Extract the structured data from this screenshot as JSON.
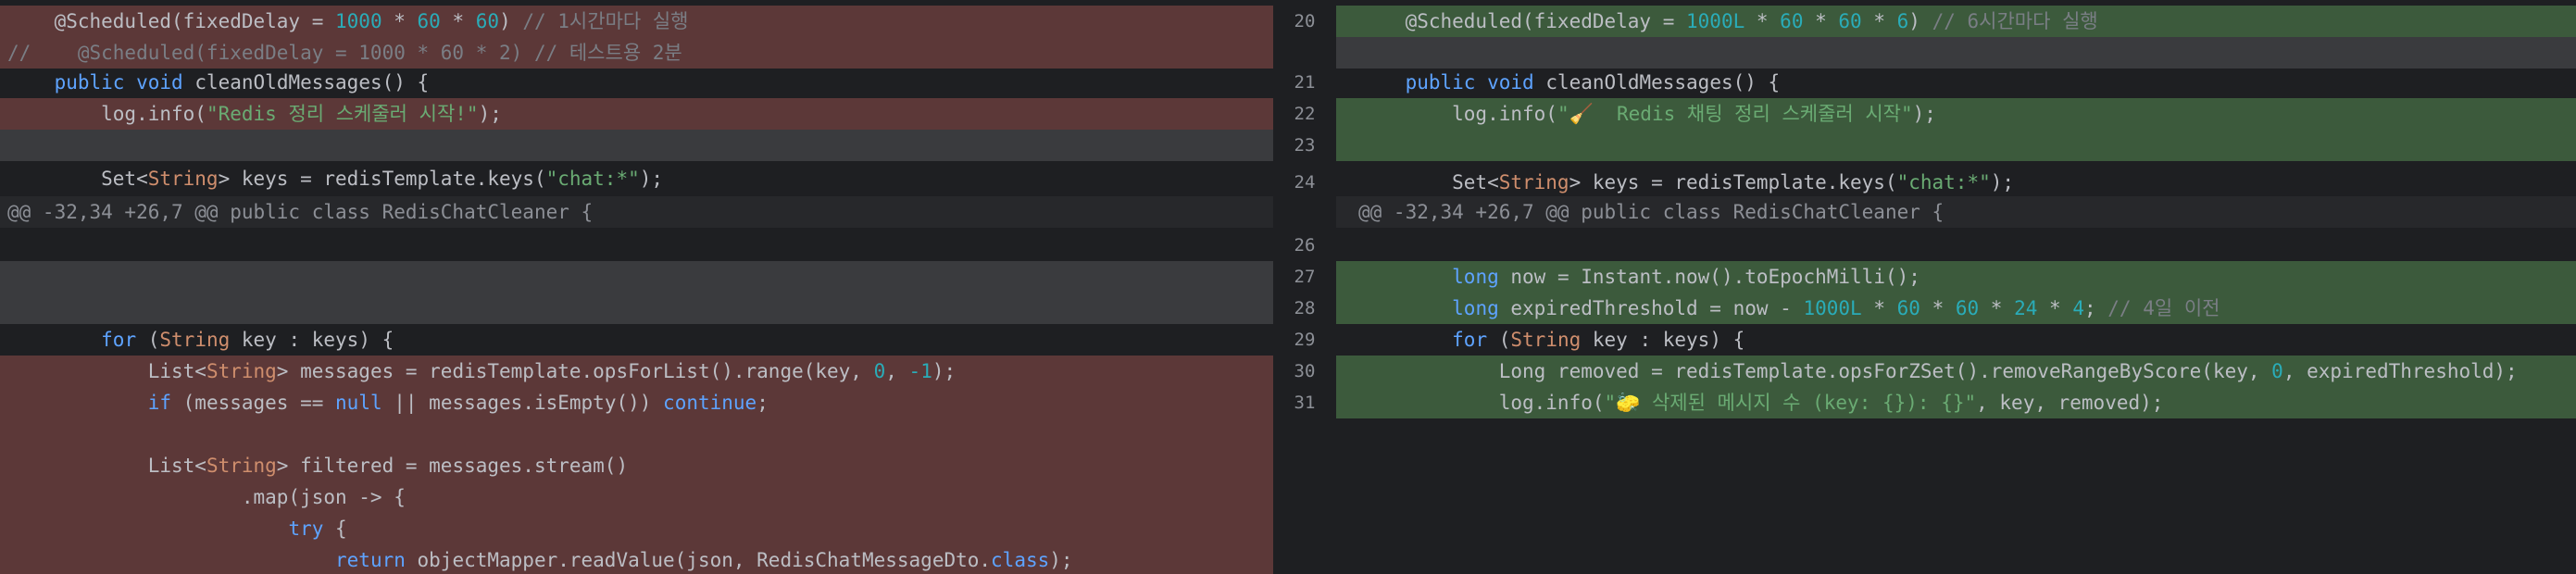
{
  "left": {
    "lines": [
      {
        "kind": "del",
        "segments": [
          {
            "t": "    @Scheduled(fixedDelay = "
          },
          {
            "t": "1000",
            "c": "num"
          },
          {
            "t": " * "
          },
          {
            "t": "60",
            "c": "num"
          },
          {
            "t": " * "
          },
          {
            "t": "60",
            "c": "num"
          },
          {
            "t": ") "
          },
          {
            "t": "// 1시간마다 실행",
            "c": "cmt"
          }
        ]
      },
      {
        "kind": "del",
        "segments": [
          {
            "t": "//    @Scheduled(fixedDelay = 1000 * 60 * 2) // 테스트용 2분",
            "c": "cmt"
          }
        ]
      },
      {
        "kind": "ctx",
        "segments": [
          {
            "t": "    "
          },
          {
            "t": "public",
            "c": "kw2"
          },
          {
            "t": " "
          },
          {
            "t": "void",
            "c": "kw2"
          },
          {
            "t": " cleanOldMessages() {"
          }
        ]
      },
      {
        "kind": "del",
        "segments": [
          {
            "t": "        log.info("
          },
          {
            "t": "\"Redis 정리 스케줄러 시작!\"",
            "c": "str"
          },
          {
            "t": ");"
          }
        ]
      },
      {
        "kind": "blank",
        "segments": []
      },
      {
        "kind": "ctx",
        "segments": [
          {
            "t": "        Set<"
          },
          {
            "t": "String",
            "c": "kw"
          },
          {
            "t": "> keys = redisTemplate.keys("
          },
          {
            "t": "\"chat:*\"",
            "c": "str"
          },
          {
            "t": ");"
          }
        ]
      },
      {
        "kind": "hunk",
        "segments": [
          {
            "t": "@@ -32,34 +26,7 @@ public class RedisChatCleaner {"
          }
        ]
      },
      {
        "kind": "ctx",
        "segments": []
      },
      {
        "kind": "blank",
        "segments": []
      },
      {
        "kind": "blank",
        "segments": []
      },
      {
        "kind": "ctx",
        "segments": [
          {
            "t": "        "
          },
          {
            "t": "for",
            "c": "kw2"
          },
          {
            "t": " ("
          },
          {
            "t": "String",
            "c": "kw"
          },
          {
            "t": " key : keys) {"
          }
        ]
      },
      {
        "kind": "del",
        "segments": [
          {
            "t": "            List<"
          },
          {
            "t": "String",
            "c": "kw"
          },
          {
            "t": "> messages = redisTemplate.opsForList().range(key, "
          },
          {
            "t": "0",
            "c": "num"
          },
          {
            "t": ", "
          },
          {
            "t": "-1",
            "c": "num"
          },
          {
            "t": ");"
          }
        ]
      },
      {
        "kind": "del",
        "segments": [
          {
            "t": "            "
          },
          {
            "t": "if",
            "c": "kw2"
          },
          {
            "t": " (messages == "
          },
          {
            "t": "null",
            "c": "kw2"
          },
          {
            "t": " || messages.isEmpty()) "
          },
          {
            "t": "continue",
            "c": "kw2"
          },
          {
            "t": ";"
          }
        ]
      },
      {
        "kind": "del",
        "segments": []
      },
      {
        "kind": "del",
        "segments": [
          {
            "t": "            List<"
          },
          {
            "t": "String",
            "c": "kw"
          },
          {
            "t": "> filtered = messages.stream()"
          }
        ]
      },
      {
        "kind": "del",
        "segments": [
          {
            "t": "                    .map(json -> {"
          }
        ]
      },
      {
        "kind": "del",
        "segments": [
          {
            "t": "                        "
          },
          {
            "t": "try",
            "c": "kw2"
          },
          {
            "t": " {"
          }
        ]
      },
      {
        "kind": "del",
        "segments": [
          {
            "t": "                            "
          },
          {
            "t": "return",
            "c": "kw2"
          },
          {
            "t": " objectMapper.readValue(json, RedisChatMessageDto."
          },
          {
            "t": "class",
            "c": "kw2"
          },
          {
            "t": ");"
          }
        ]
      }
    ]
  },
  "right": {
    "lines": [
      {
        "kind": "add",
        "no": "20",
        "segments": [
          {
            "t": "    @Scheduled(fixedDelay = "
          },
          {
            "t": "1000L",
            "c": "num"
          },
          {
            "t": " * "
          },
          {
            "t": "60",
            "c": "num"
          },
          {
            "t": " * "
          },
          {
            "t": "60",
            "c": "num"
          },
          {
            "t": " * "
          },
          {
            "t": "6",
            "c": "num"
          },
          {
            "t": ") "
          },
          {
            "t": "// 6시간마다 실행",
            "c": "cmt"
          }
        ]
      },
      {
        "kind": "blank",
        "no": "",
        "segments": []
      },
      {
        "kind": "ctx",
        "no": "21",
        "segments": [
          {
            "t": "    "
          },
          {
            "t": "public",
            "c": "kw2"
          },
          {
            "t": " "
          },
          {
            "t": "void",
            "c": "kw2"
          },
          {
            "t": " cleanOldMessages() {"
          }
        ]
      },
      {
        "kind": "add",
        "no": "22",
        "segments": [
          {
            "t": "        log.info("
          },
          {
            "t": "\"🧹  Redis 채팅 정리 스케줄러 시작\"",
            "c": "str"
          },
          {
            "t": ");"
          }
        ]
      },
      {
        "kind": "add",
        "no": "23",
        "segments": []
      },
      {
        "kind": "ctx",
        "no": "24",
        "segments": [
          {
            "t": "        Set<"
          },
          {
            "t": "String",
            "c": "kw"
          },
          {
            "t": "> keys = redisTemplate.keys("
          },
          {
            "t": "\"chat:*\"",
            "c": "str"
          },
          {
            "t": ");"
          }
        ]
      },
      {
        "kind": "hunk",
        "no": "",
        "segments": [
          {
            "t": "@@ -32,34 +26,7 @@ public class RedisChatCleaner {"
          }
        ]
      },
      {
        "kind": "ctx",
        "no": "26",
        "segments": []
      },
      {
        "kind": "add",
        "no": "27",
        "segments": [
          {
            "t": "        "
          },
          {
            "t": "long",
            "c": "kw2"
          },
          {
            "t": " now = Instant.now().toEpochMilli();"
          }
        ]
      },
      {
        "kind": "add",
        "no": "28",
        "segments": [
          {
            "t": "        "
          },
          {
            "t": "long",
            "c": "kw2"
          },
          {
            "t": " expiredThreshold = now - "
          },
          {
            "t": "1000L",
            "c": "num"
          },
          {
            "t": " * "
          },
          {
            "t": "60",
            "c": "num"
          },
          {
            "t": " * "
          },
          {
            "t": "60",
            "c": "num"
          },
          {
            "t": " * "
          },
          {
            "t": "24",
            "c": "num"
          },
          {
            "t": " * "
          },
          {
            "t": "4",
            "c": "num"
          },
          {
            "t": "; "
          },
          {
            "t": "// 4일 이전",
            "c": "cmt"
          }
        ]
      },
      {
        "kind": "ctx",
        "no": "29",
        "segments": [
          {
            "t": "        "
          },
          {
            "t": "for",
            "c": "kw2"
          },
          {
            "t": " ("
          },
          {
            "t": "String",
            "c": "kw"
          },
          {
            "t": " key : keys) {"
          }
        ]
      },
      {
        "kind": "add",
        "no": "30",
        "segments": [
          {
            "t": "            Long removed = redisTemplate.opsForZSet().removeRangeByScore(key, "
          },
          {
            "t": "0",
            "c": "num"
          },
          {
            "t": ", expiredThreshold);"
          }
        ]
      },
      {
        "kind": "add",
        "no": "31",
        "segments": [
          {
            "t": "            log.info("
          },
          {
            "t": "\"🧽 삭제된 메시지 수 (key: {}): {}\"",
            "c": "str"
          },
          {
            "t": ", key, removed);"
          }
        ]
      }
    ]
  }
}
